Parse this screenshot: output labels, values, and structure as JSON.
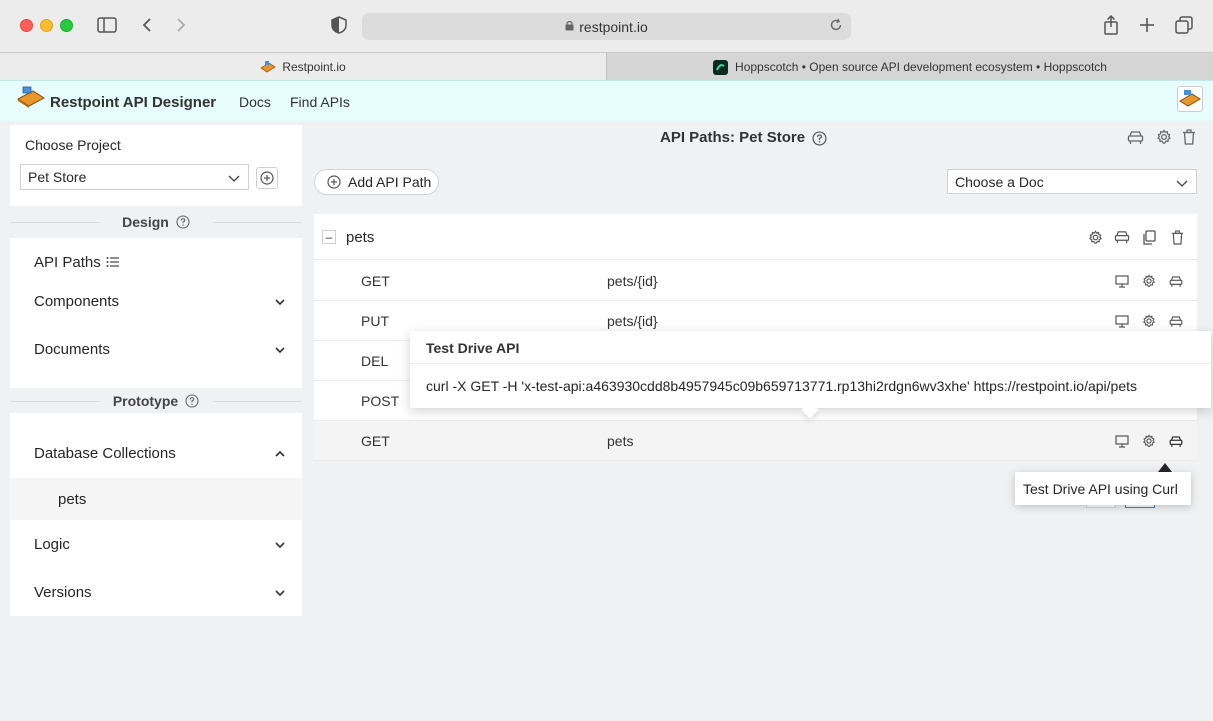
{
  "browser": {
    "url": "restpoint.io",
    "tabs": [
      {
        "label": "Restpoint.io"
      },
      {
        "label": "Hoppscotch • Open source API development ecosystem • Hoppscotch"
      }
    ]
  },
  "app": {
    "title": "Restpoint API Designer",
    "nav": [
      "Docs",
      "Find APIs"
    ]
  },
  "sidebar": {
    "choose_project_label": "Choose Project",
    "project_select": "Pet Store",
    "design_label": "Design",
    "design_items": [
      {
        "label": "API Paths"
      },
      {
        "label": "Components"
      },
      {
        "label": "Documents"
      }
    ],
    "prototype_label": "Prototype",
    "prototype_items": [
      {
        "label": "Database Collections"
      },
      {
        "label": "Logic"
      },
      {
        "label": "Versions"
      }
    ],
    "collections": [
      "pets"
    ]
  },
  "main": {
    "title": "API Paths: Pet Store",
    "add_button": "Add API Path",
    "doc_select": "Choose a Doc",
    "group_name": "pets",
    "rows": [
      {
        "method": "GET",
        "path": "pets/{id}"
      },
      {
        "method": "PUT",
        "path": "pets/{id}"
      },
      {
        "method": "DEL",
        "path": ""
      },
      {
        "method": "POST",
        "path": ""
      },
      {
        "method": "GET",
        "path": "pets"
      }
    ]
  },
  "popover": {
    "title": "Test Drive API",
    "command": "curl -X GET -H 'x-test-api:a463930cdd8b4957945c09b659713771.rp13hi2rdgn6wv3xhe' https://restpoint.io/api/pets"
  },
  "tooltip": {
    "text": "Test Drive API using Curl"
  },
  "colors": {
    "header_bg": "#e6fcfd",
    "page_bg": "#f0f1f3"
  }
}
